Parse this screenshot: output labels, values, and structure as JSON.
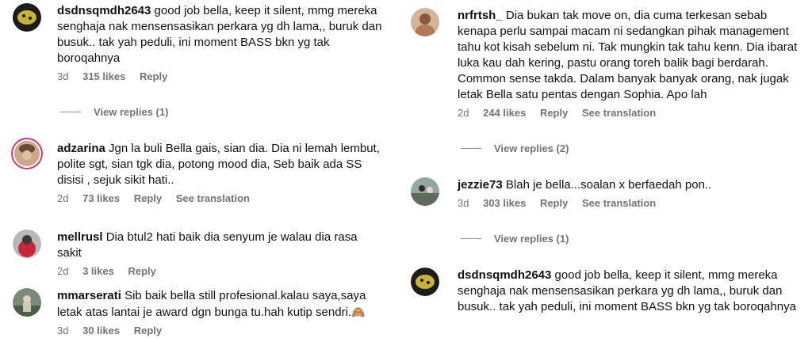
{
  "left": {
    "comments": [
      {
        "username": "dsdnsqmdh2643",
        "text": "good job bella, keep it silent, mmg mereka senghaja nak mensensasikan perkara yg dh lama,, buruk dan busuk.. tak yah peduli, ini moment BASS bkn yg tak boroqahnya",
        "time": "3d",
        "likes": "315 likes",
        "reply": "Reply",
        "view_replies": "View replies (1)"
      },
      {
        "username": "adzarina",
        "text": "Jgn la buli Bella gais, sian dia. Dia ni lemah lembut, polite sgt, sian tgk dia, potong mood dia, Seb baik ada SS disisi , sejuk sikit hati..",
        "time": "2d",
        "likes": "73 likes",
        "reply": "Reply",
        "translation": "See translation"
      },
      {
        "username": "mellrusl",
        "text": "Dia btul2 hati baik dia senyum je walau dia rasa sakit",
        "time": "2d",
        "likes": "3 likes",
        "reply": "Reply"
      },
      {
        "username": "mmarserati",
        "text": "Sib baik bella still profesional.kalau saya,saya letak atas lantai je award dgn bunga tu.hah kutip sendri.",
        "emoji": "🙈",
        "time": "3d",
        "likes": "30 likes",
        "reply": "Reply"
      }
    ]
  },
  "right": {
    "comments": [
      {
        "username": "nrfrtsh_",
        "text": "Dia bukan tak move on, dia cuma terkesan sebab kenapa perlu sampai macam ni sedangkan pihak management tahu kot kisah sebelum ni. Tak mungkin tak tahu kenn. Dia ibarat luka kau dah kering, pastu orang toreh balik bagi berdarah. Common sense takda. Dalam banyak banyak orang, nak jugak letak Bella satu pentas dengan Sophia. Apo lah",
        "time": "2d",
        "likes": "244 likes",
        "reply": "Reply",
        "translation": "See translation",
        "view_replies": "View replies (2)"
      },
      {
        "username": "jezzie73",
        "text": "Blah je bella...soalan x berfaedah pon..",
        "time": "3d",
        "likes": "303 likes",
        "reply": "Reply",
        "translation": "See translation",
        "view_replies": "View replies (1)"
      },
      {
        "username": "dsdnsqmdh2643",
        "text": "good job bella, keep it silent, mmg mereka senghaja nak mensensasikan perkara yg dh lama,, buruk dan busuk.. tak yah peduli, ini moment BASS bkn yg tak boroqahnya"
      }
    ]
  },
  "colors": {
    "meta": "#737373",
    "text": "#111111",
    "story_ring": "#d62976"
  }
}
